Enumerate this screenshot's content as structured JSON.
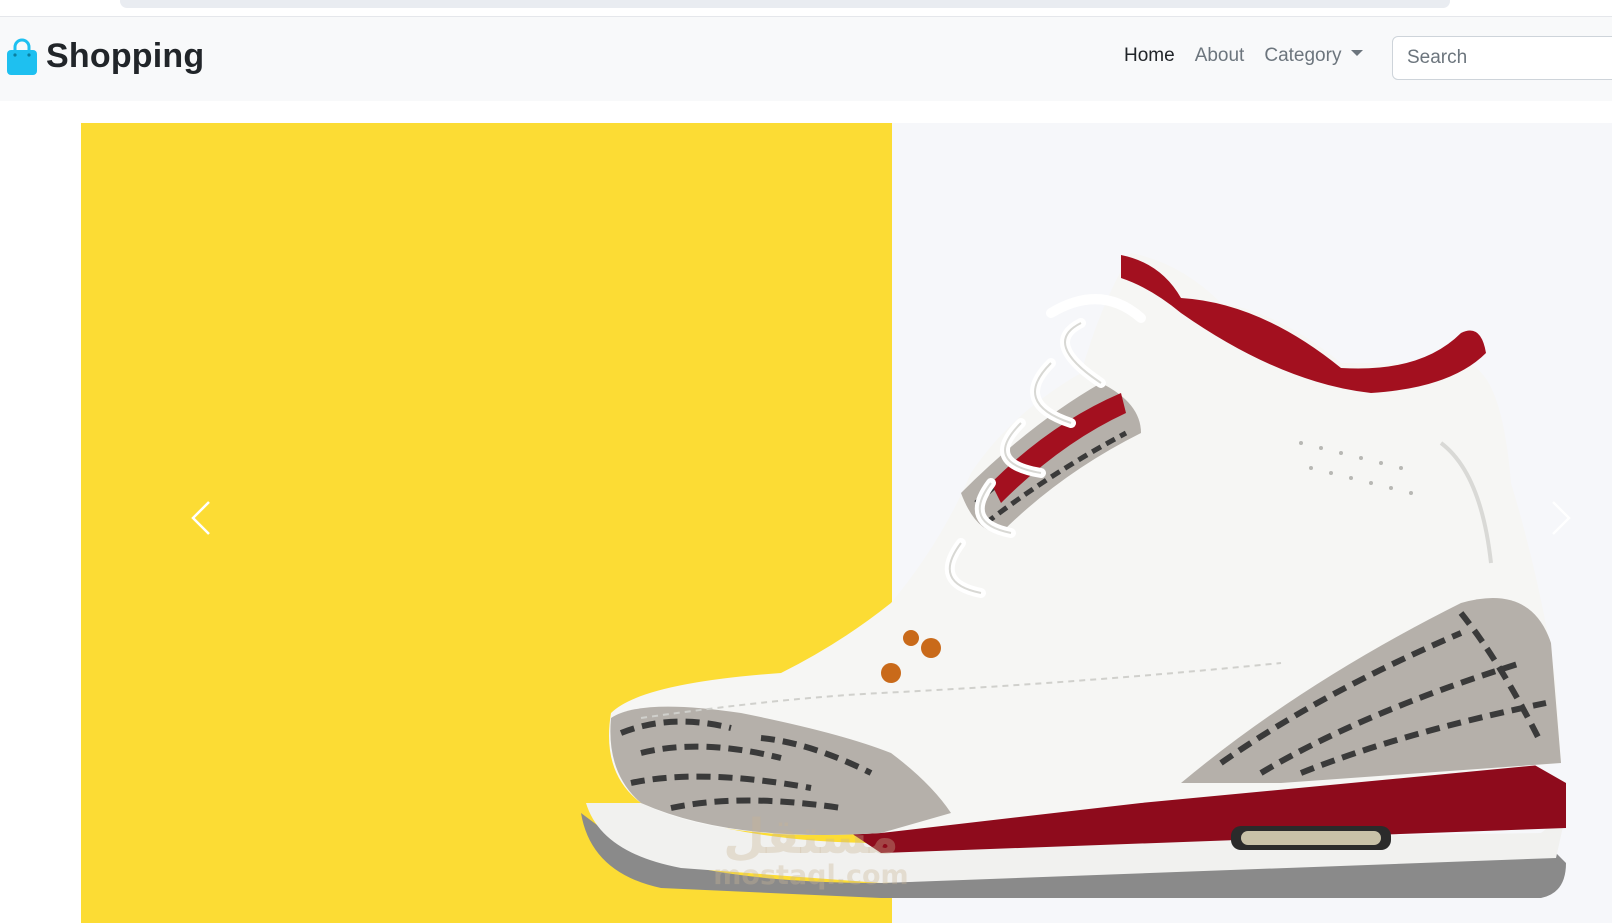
{
  "navbar": {
    "brand": "Shopping",
    "links": [
      {
        "label": "Home",
        "active": true
      },
      {
        "label": "About",
        "active": false
      }
    ],
    "dropdown": {
      "label": "Category"
    },
    "search": {
      "placeholder": "Search",
      "value": ""
    }
  },
  "carousel": {
    "image": "sneaker-icon",
    "panel_color": "#fcdc34",
    "background_color": "#f6f7fa",
    "controls": [
      "chevron-left-icon",
      "chevron-right-icon"
    ]
  },
  "watermark": {
    "arabic": "مستقل",
    "latin": "mostaql.com"
  },
  "colors": {
    "brand_icon": "#1ec0f0",
    "accent_red": "#9a0a1c"
  }
}
